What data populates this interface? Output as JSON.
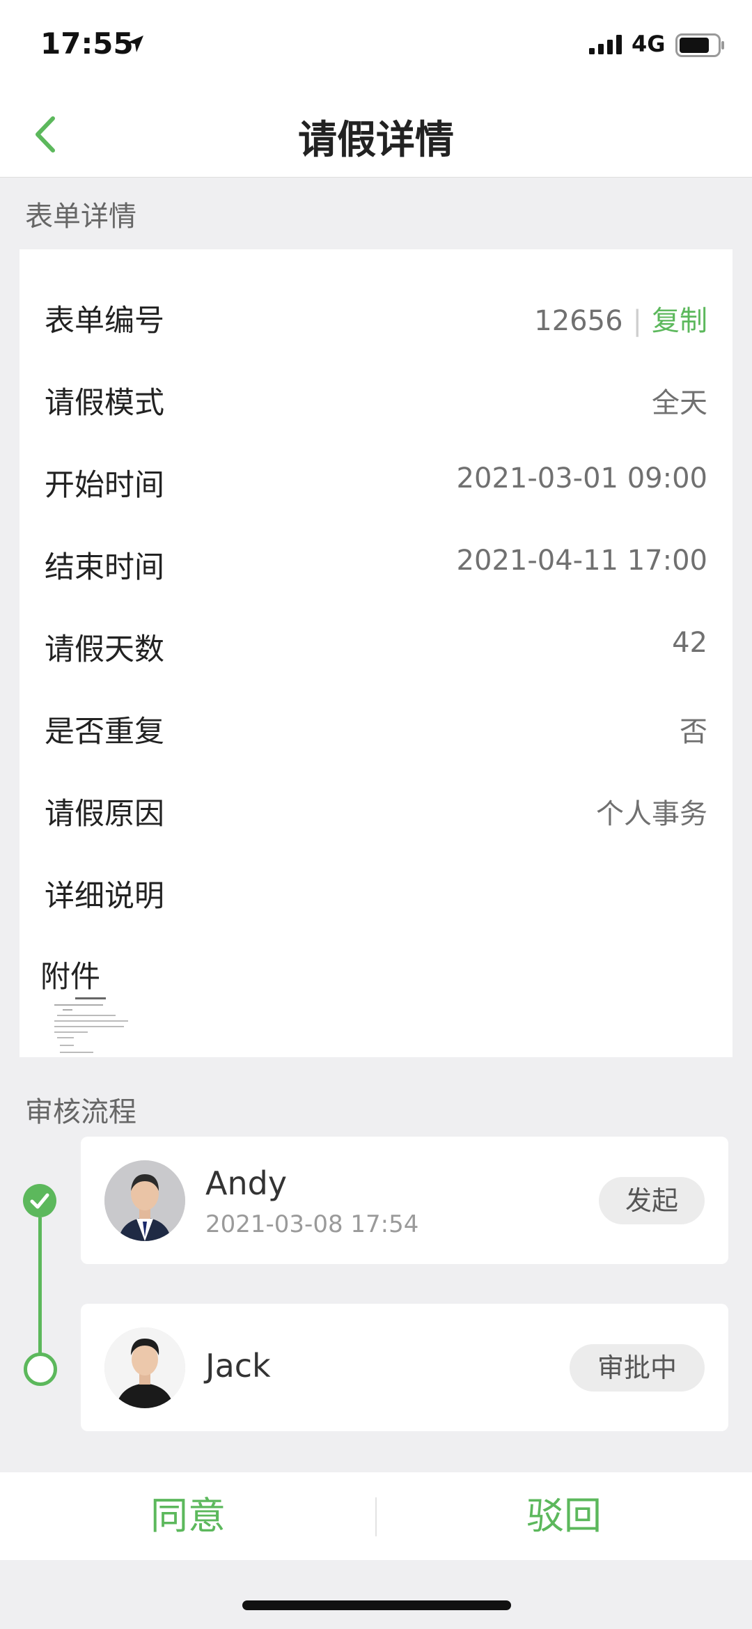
{
  "status_bar": {
    "time": "17:55",
    "network": "4G",
    "icons": [
      "location-arrow-icon",
      "signal-icon",
      "battery-icon"
    ]
  },
  "nav": {
    "title": "请假详情",
    "back_icon": "chevron-left-icon"
  },
  "form": {
    "section_title": "表单详情",
    "form_number_label": "表单编号",
    "form_number_value": "12656",
    "copy_label": "复制",
    "rows": [
      {
        "label": "请假模式",
        "value": "全天"
      },
      {
        "label": "开始时间",
        "value": "2021-03-01 09:00"
      },
      {
        "label": "结束时间",
        "value": "2021-04-11 17:00"
      },
      {
        "label": "请假天数",
        "value": "42"
      },
      {
        "label": "是否重复",
        "value": "否"
      },
      {
        "label": "请假原因",
        "value": "个人事务"
      },
      {
        "label": "详细说明",
        "value": ""
      }
    ],
    "attachment_label": "附件"
  },
  "approval": {
    "section_title": "审核流程",
    "steps": [
      {
        "name": "Andy",
        "time": "2021-03-08 17:54",
        "status": "发起"
      },
      {
        "name": "Jack",
        "time": "",
        "status": "审批中"
      }
    ]
  },
  "actions": {
    "approve_label": "同意",
    "reject_label": "驳回"
  },
  "colors": {
    "accent": "#5cb85c",
    "background": "#efeff1"
  }
}
